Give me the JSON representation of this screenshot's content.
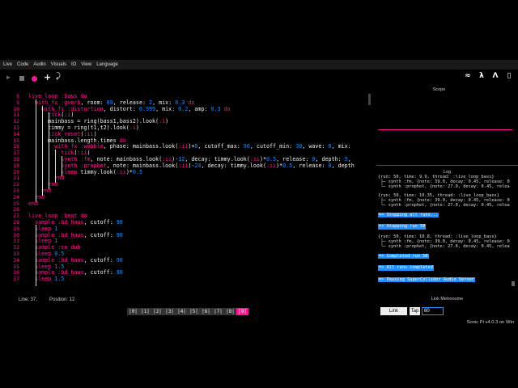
{
  "menu": {
    "items": [
      "Live",
      "Code",
      "Audio",
      "Visuals",
      "IO",
      "View",
      "Language"
    ]
  },
  "toolbar": {
    "play_icon": "▶",
    "plus_icon": "+",
    "undo_icon": "⤸",
    "right_icons": [
      "≈",
      "λ",
      "Λ",
      "▯"
    ]
  },
  "editor": {
    "line_numbers": [
      "8",
      "9",
      "10",
      "11",
      "12",
      "13",
      "14",
      "15",
      "16",
      "17",
      "18",
      "19",
      "20",
      "21",
      "22",
      "23",
      "24",
      "25",
      "26",
      "27",
      "28",
      "29",
      "30",
      "31",
      "32",
      "33",
      "34",
      "35",
      "36",
      "37"
    ],
    "lines": [
      "live_loop :bass do",
      "  with_fx :gverb, room: 69, release: 2, mix: 0.3 do",
      "    with_fx :distortion, distort: 0.999, mix: 0.2, amp: 0.3 do",
      "      tick(:i)",
      "      mainbass = ring(bass1,bass2).look(:i)",
      "      timmy = ring(t1,t2).look(:i)",
      "      tick_reset(:ii)",
      "      mainbass.length.times do",
      "        with_fx :wobble, phase: mainbass.look(:ii)+0, cutoff_max: 90, cutoff_min: 30, wave: 0, mix:",
      "          tick(:ii)",
      "          synth :fm, note: mainbass.look(:ii)-12, decay: timmy.look(:ii)*0.5, release: 0, depth: 5,",
      "          synth :prophet, note: mainbass.look(:ii)-24, decay: timmy.look(:ii)*0.5, release: 0, depth",
      "          sleep timmy.look(:ii)*0.5",
      "        end",
      "      end",
      "    end",
      "  end",
      "end",
      "",
      "live_loop :beat do",
      "  sample :bd_haus, cutoff: 90",
      "  sleep 1",
      "  sample :bd_haus, cutoff: 90",
      "  sleep 1",
      "  sample :sn_dub",
      "  sleep 0.5",
      "  sample :bd_haus, cutoff: 90",
      "  sleep 1.5",
      "  sample :bd_haus, cutoff: 90",
      "  sleep 1.5"
    ]
  },
  "status": {
    "line": "Line: 37,",
    "position": "Position: 12"
  },
  "buffers": {
    "tabs": [
      "|0|",
      "|1|",
      "|2|",
      "|3|",
      "|4|",
      "|5|",
      "|6|",
      "|7|",
      "|8|",
      "|9|"
    ],
    "active_index": 9
  },
  "scope": {
    "title": "Scope"
  },
  "log": {
    "title": "Log",
    "entries": [
      {
        "type": "lines",
        "lines": [
          "{run: 50, time: 9.9, thread: :live_loop_bass}",
          " ├─ synth :fm, {note: 39.0, decay: 0.45, release: 0",
          " └─ synth :prophet, {note: 27.0, decay: 0.45, relea"
        ]
      },
      {
        "type": "lines",
        "lines": [
          "{run: 50, time: 10.35, thread: :live_loop_bass}",
          " ├─ synth :fm, {note: 39.0, decay: 0.45, release: 0",
          " └─ synth :prophet, {note: 27.0, decay: 0.45, relea"
        ]
      },
      {
        "type": "badge",
        "text": "=> Stopping all runs..."
      },
      {
        "type": "badge",
        "text": "=> Stopping run 50"
      },
      {
        "type": "lines",
        "lines": [
          "{run: 50, time: 10.8, thread: :live_loop_bass}",
          " ├─ synth :fm, {note: 39.0, decay: 0.45, release: 0",
          " └─ synth :prophet, {note: 27.0, decay: 0.45, relea"
        ]
      },
      {
        "type": "badge",
        "text": "=> Completed run 50"
      },
      {
        "type": "badge",
        "text": "=> All runs completed"
      },
      {
        "type": "badge",
        "text": "=> Pausing SuperCollider Audio Server"
      }
    ]
  },
  "link": {
    "title": "Link Metronome",
    "link_label": "Link",
    "tap_label": "Tap",
    "bpm": "60"
  },
  "version": "Sonic Pi v4.0.3 on Win"
}
